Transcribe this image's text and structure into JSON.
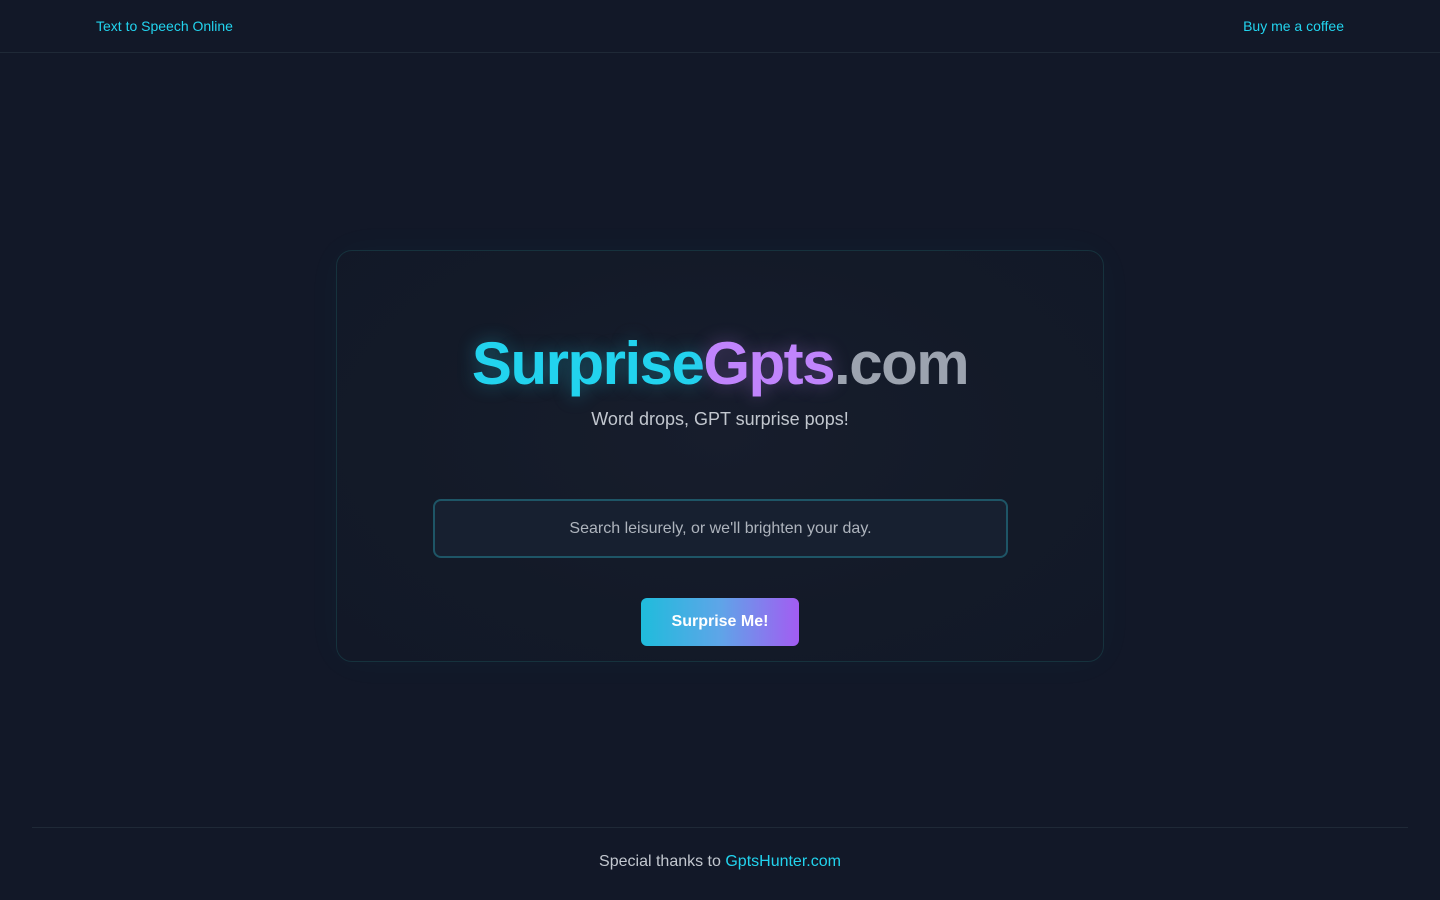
{
  "nav": {
    "left_link": "Text to Speech Online",
    "right_link": "Buy me a coffee"
  },
  "hero": {
    "title_part1": "Surprise",
    "title_part2": "Gpts",
    "title_part3": ".com",
    "subtitle": "Word drops, GPT surprise pops!"
  },
  "search": {
    "placeholder": "Search leisurely, or we'll brighten your day.",
    "value": ""
  },
  "button": {
    "label": "Surprise Me!"
  },
  "footer": {
    "text": "Special thanks to",
    "link": "GptsHunter.com"
  },
  "colors": {
    "background": "#121828",
    "accent_cyan": "#22d3ee",
    "accent_purple": "#c084fc",
    "muted_gray": "#9ca3af"
  }
}
